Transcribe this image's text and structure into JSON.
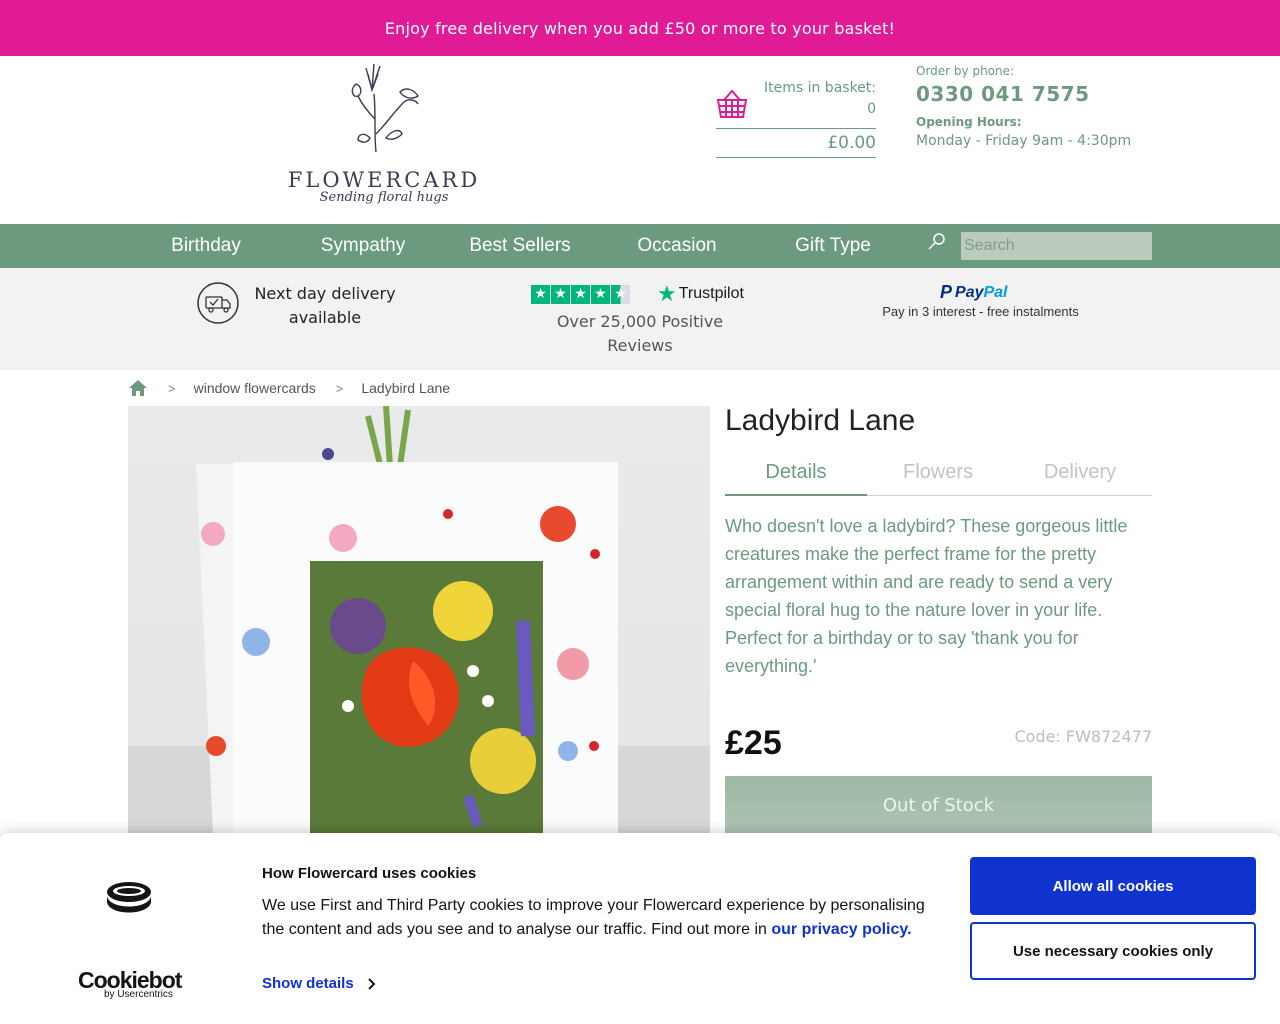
{
  "promo": {
    "text": "Enjoy free delivery when you add £50 or more to your basket!"
  },
  "logo": {
    "wordmark": "FLOWERCARD",
    "tagline": "Sending floral hugs"
  },
  "basket": {
    "label": "Items in basket:",
    "count": "0",
    "total": "£0.00"
  },
  "contact": {
    "order_label": "Order by phone:",
    "phone": "0330 041 7575",
    "hours_label": "Opening Hours:",
    "hours": "Monday - Friday 9am - 4:30pm"
  },
  "nav": {
    "items": [
      "Birthday",
      "Sympathy",
      "Best Sellers",
      "Occasion",
      "Gift Type"
    ],
    "search_placeholder": "Search"
  },
  "trust": {
    "delivery": "Next day delivery available",
    "trustpilot_brand": "Trustpilot",
    "trustpilot_text": "Over 25,000 Positive Reviews",
    "paypal_pay": "Pay",
    "paypal_pal": "Pal",
    "paypal_sub": "Pay in 3 interest - free instalments"
  },
  "breadcrumb": {
    "items": [
      "window flowercards",
      "Ladybird Lane"
    ]
  },
  "product": {
    "title": "Ladybird Lane",
    "tabs": [
      "Details",
      "Flowers",
      "Delivery"
    ],
    "active_tab": "Details",
    "description": "Who doesn't love a ladybird? These gorgeous little creatures make the perfect frame for the pretty arrangement within and are ready to send a very special floral hug to the nature lover in your life. Perfect for a birthday or to say 'thank you for everything.'",
    "price": "£25",
    "code": "Code: FW872477",
    "button": "Out of Stock"
  },
  "cookies": {
    "title": "How Flowercard uses cookies",
    "text": "We use First and Third Party cookies to improve your Flowercard experience by personalising the content and ads you see and to analyse our traffic. Find out more in",
    "link": "our privacy policy.",
    "details": "Show details",
    "allow": "Allow all cookies",
    "necessary": "Use necessary cookies only",
    "brand": "Cookiebot",
    "brand_sub": "by Usercentrics"
  },
  "colors": {
    "promo": "#e01b95",
    "brand_green": "#6b9a7e",
    "cookie_blue": "#1032cf"
  }
}
